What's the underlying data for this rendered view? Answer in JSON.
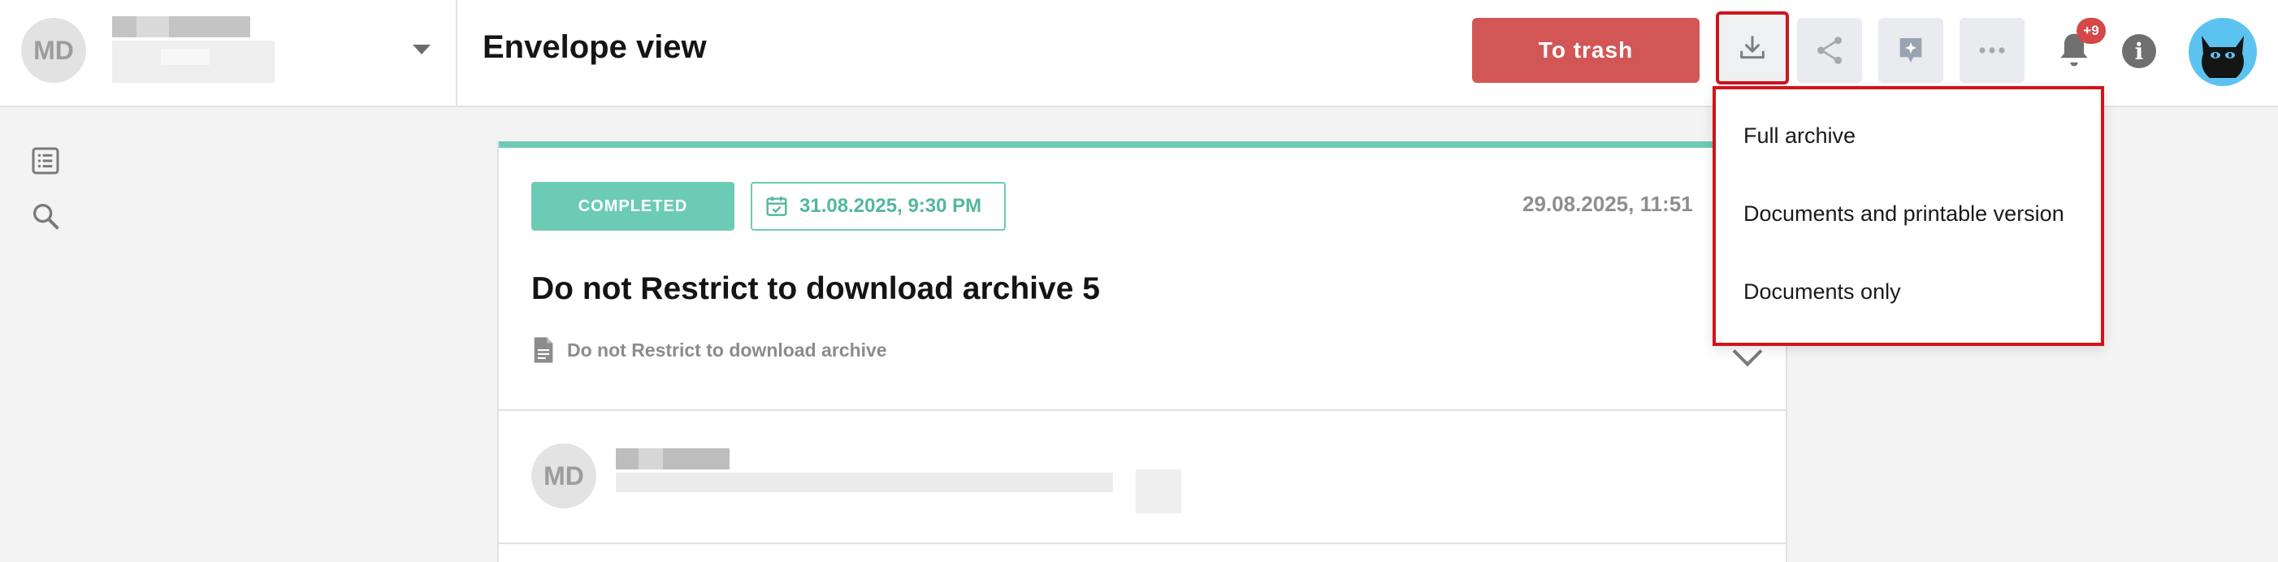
{
  "header": {
    "avatar_initials": "MD",
    "page_title": "Envelope view",
    "trash_label": "To trash",
    "notification_count": "+9"
  },
  "envelope": {
    "status": "COMPLETED",
    "deadline": "31.08.2025, 9:30 PM",
    "created": "29.08.2025, 11:51",
    "title": "Do not Restrict to download archive 5",
    "document_name": "Do not Restrict to download archive",
    "participant_initials": "MD"
  },
  "download_menu": {
    "items": [
      {
        "label": "Full archive"
      },
      {
        "label": "Documents and printable version"
      },
      {
        "label": "Documents only"
      }
    ]
  },
  "colors": {
    "accent_green": "#6ccbb5",
    "trash_red": "#d35656",
    "highlight_red": "#d0141c"
  }
}
